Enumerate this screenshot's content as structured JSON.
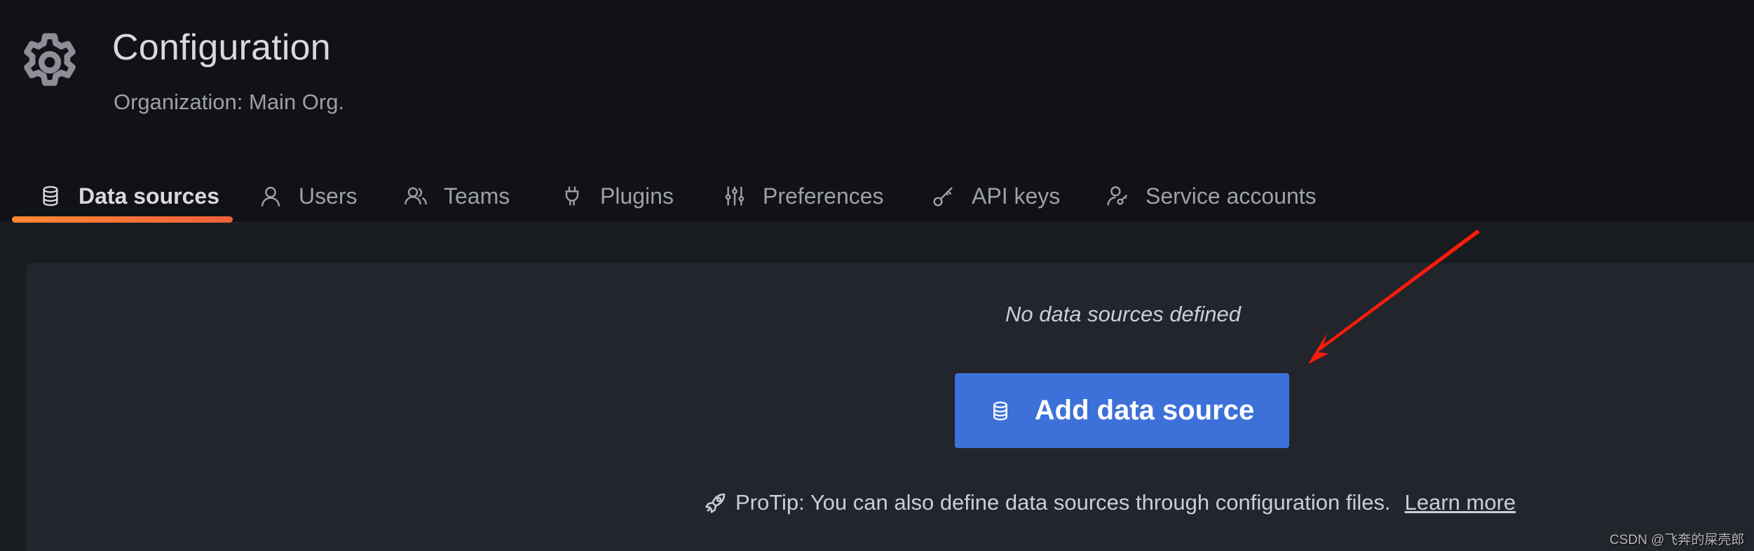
{
  "header": {
    "icon": "gear-icon",
    "title": "Configuration",
    "subtitle": "Organization: Main Org."
  },
  "tabs": [
    {
      "label": "Data sources",
      "icon": "database-icon",
      "active": true
    },
    {
      "label": "Users",
      "icon": "user-icon",
      "active": false
    },
    {
      "label": "Teams",
      "icon": "users-icon",
      "active": false
    },
    {
      "label": "Plugins",
      "icon": "plug-icon",
      "active": false
    },
    {
      "label": "Preferences",
      "icon": "sliders-icon",
      "active": false
    },
    {
      "label": "API keys",
      "icon": "key-icon",
      "active": false
    },
    {
      "label": "Service accounts",
      "icon": "user-key-icon",
      "active": false
    }
  ],
  "empty_state": {
    "message": "No data sources defined",
    "button_label": "Add data source",
    "button_icon": "database-icon",
    "protip_icon": "rocket-icon",
    "protip_text": "ProTip: You can also define data sources through configuration files.",
    "protip_link": "Learn more"
  },
  "colors": {
    "accent_underline": "#ff8833",
    "primary_button": "#3d71d9",
    "annotation_arrow": "#ff1a0a"
  },
  "watermark": "CSDN @飞奔的屎壳郎"
}
